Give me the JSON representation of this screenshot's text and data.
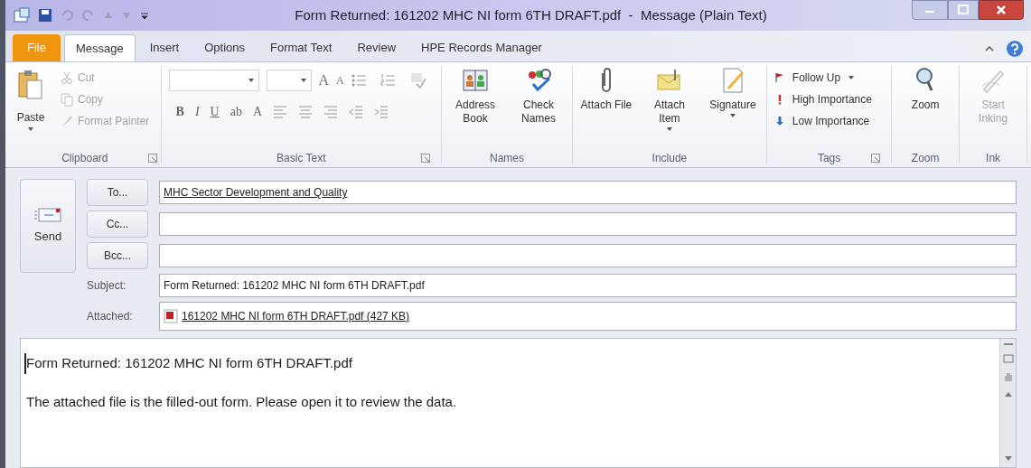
{
  "window": {
    "title": "Form Returned: 161202 MHC NI form 6TH DRAFT.pdf  -  Message (Plain Text)"
  },
  "tabs": [
    {
      "label": "File",
      "kind": "backstage",
      "selected": false
    },
    {
      "label": "Message",
      "kind": "tab",
      "selected": true
    },
    {
      "label": "Insert",
      "kind": "tab",
      "selected": false
    },
    {
      "label": "Options",
      "kind": "tab",
      "selected": false
    },
    {
      "label": "Format Text",
      "kind": "tab",
      "selected": false
    },
    {
      "label": "Review",
      "kind": "tab",
      "selected": false
    },
    {
      "label": "HPE Records Manager",
      "kind": "tab",
      "selected": false
    }
  ],
  "ribbon": {
    "clipboard": {
      "label": "Clipboard",
      "paste": {
        "label": "Paste",
        "dropdown": true
      },
      "items": [
        {
          "label": "Cut",
          "kind": "cut",
          "disabled": true
        },
        {
          "label": "Copy",
          "kind": "copy",
          "disabled": true
        },
        {
          "label": "Format Painter",
          "kind": "painter",
          "disabled": true
        }
      ]
    },
    "basic_text": {
      "label": "Basic Text",
      "format_buttons": [
        {
          "label": "B",
          "kind": "bold"
        },
        {
          "label": "I",
          "kind": "italic"
        },
        {
          "label": "U",
          "kind": "underline"
        },
        {
          "label": "ab",
          "kind": "highlight"
        },
        {
          "label": "A",
          "kind": "color"
        }
      ],
      "size_buttons": [
        {
          "label": "A",
          "kind": "grow"
        },
        {
          "label": "A",
          "kind": "shrink"
        }
      ]
    },
    "groups": [
      {
        "label": "Names",
        "items": [
          {
            "label": "Address Book",
            "kind": "address_book",
            "dropdown": false,
            "disabled": false
          },
          {
            "label": "Check Names",
            "kind": "check_names",
            "dropdown": false,
            "disabled": false
          }
        ]
      },
      {
        "label": "Include",
        "items": [
          {
            "label": "Attach File",
            "kind": "attach_file",
            "dropdown": false,
            "disabled": false
          },
          {
            "label": "Attach Item",
            "kind": "attach_item",
            "dropdown": true,
            "disabled": false
          },
          {
            "label": "Signature",
            "kind": "signature",
            "dropdown": true,
            "disabled": false
          }
        ]
      }
    ],
    "tags": {
      "label": "Tags",
      "items": [
        {
          "label": "Follow Up",
          "kind": "follow_up",
          "dropdown": true
        },
        {
          "label": "High Importance",
          "kind": "high",
          "dropdown": false
        },
        {
          "label": "Low Importance",
          "kind": "low",
          "dropdown": false
        }
      ]
    },
    "tail_groups": [
      {
        "label": "Zoom",
        "items": [
          {
            "label": "Zoom",
            "kind": "zoom",
            "dropdown": false,
            "disabled": false
          }
        ]
      },
      {
        "label": "Ink",
        "items": [
          {
            "label": "Start Inking",
            "kind": "ink",
            "dropdown": false,
            "disabled": true
          }
        ]
      }
    ]
  },
  "send": {
    "label": "Send"
  },
  "recipients": [
    {
      "button": "To...",
      "value": "MHC Sector Development and Quality"
    },
    {
      "button": "Cc..."
    },
    {
      "button": "Bcc..."
    }
  ],
  "subject": {
    "label": "Subject:",
    "value": "Form Returned: 161202 MHC NI form 6TH DRAFT.pdf"
  },
  "attached": {
    "label": "Attached:",
    "file": "161202 MHC NI form 6TH DRAFT.pdf (427 KB)"
  },
  "body": [
    "Form Returned: 161202 MHC NI form 6TH DRAFT.pdf",
    "The attached file is the filled-out form. Please open it to review the data."
  ]
}
